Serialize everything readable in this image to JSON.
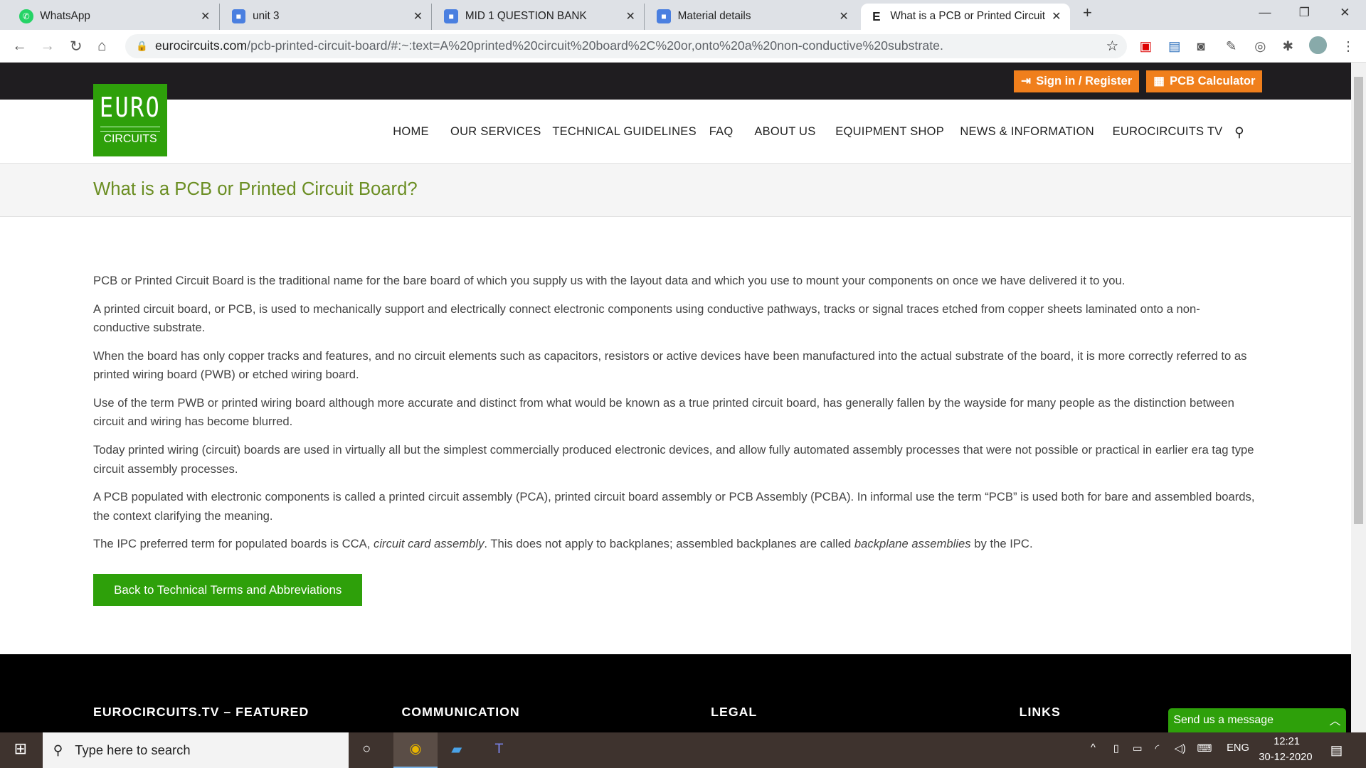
{
  "browser": {
    "tabs": [
      {
        "title": "WhatsApp",
        "icon": "whatsapp-icon"
      },
      {
        "title": "unit 3",
        "icon": "classroom-icon"
      },
      {
        "title": "MID 1 QUESTION BANK",
        "icon": "classroom-icon"
      },
      {
        "title": "Material details",
        "icon": "classroom-icon"
      },
      {
        "title": "What is a PCB or Printed Circuit B",
        "icon": "eurocircuits-icon"
      }
    ],
    "url_host": "eurocircuits.com",
    "url_path": "/pcb-printed-circuit-board/#:~:text=A%20printed%20circuit%20board%2C%20or,onto%20a%20non-conductive%20substrate."
  },
  "topbar": {
    "sign_in": "Sign in / Register",
    "calculator": "PCB Calculator"
  },
  "logo": {
    "line1": "EURO",
    "line2": "CIRCUITS"
  },
  "menu": [
    "HOME",
    "OUR SERVICES",
    "TECHNICAL GUIDELINES",
    "FAQ",
    "ABOUT US",
    "EQUIPMENT SHOP",
    "NEWS & INFORMATION",
    "EUROCIRCUITS TV"
  ],
  "page": {
    "title": "What is a PCB or Printed Circuit Board?",
    "paragraphs": [
      "PCB or Printed Circuit Board is the traditional name for the bare board of which you supply us with the layout data and which you use to mount your components on once we have delivered it to you.",
      "A printed circuit board, or PCB, is used to mechanically support and electrically connect electronic components using conductive pathways, tracks or signal traces etched from copper sheets laminated onto a non-conductive substrate.",
      "When the board has only copper tracks and features, and no circuit elements such as capacitors, resistors or active devices have been manufactured into the actual substrate of the board, it is more correctly referred to as printed wiring board (PWB) or etched wiring board.",
      "Use of the term PWB or printed wiring board although more accurate and distinct from what would be known as a true printed circuit board, has generally fallen by the wayside for many people as the distinction between circuit and wiring has become blurred.",
      "Today printed wiring (circuit) boards are used in virtually all but the simplest commercially produced electronic devices, and allow fully automated assembly processes that were not possible or practical in earlier era tag type circuit assembly processes.",
      "A PCB populated with electronic components is called a printed circuit assembly (PCA), printed circuit board assembly or PCB Assembly (PCBA). In informal use the term “PCB” is used both for bare and assembled boards, the context clarifying the meaning."
    ],
    "last": {
      "a": "The IPC preferred term for populated boards is CCA, ",
      "b": "circuit card assembly",
      "c": ". This does not apply to backplanes; assembled backplanes are called ",
      "d": "backplane assemblies",
      "e": " by the IPC."
    },
    "back_button": "Back to Technical Terms and Abbreviations"
  },
  "footer": {
    "headings": [
      "EUROCIRCUITS.TV – FEATURED",
      "COMMUNICATION",
      "LEGAL",
      "LINKS"
    ]
  },
  "chat": {
    "label": "Send us a message"
  },
  "taskbar": {
    "search_placeholder": "Type here to search",
    "lang": "ENG",
    "time": "12:21",
    "date": "30-12-2020"
  }
}
